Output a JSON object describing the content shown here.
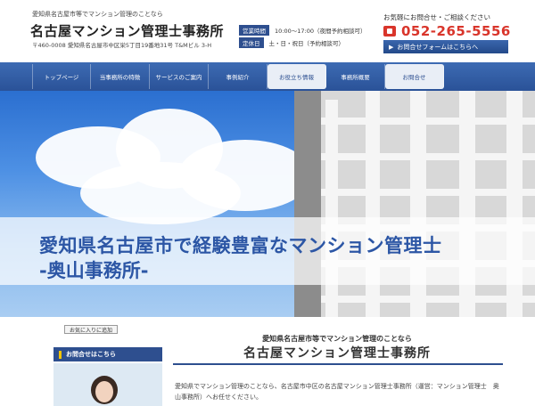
{
  "header": {
    "tagline": "愛知県名古屋市等でマンション管理のことなら",
    "site_title": "名古屋マンション管理士事務所",
    "address": "〒460-0008 愛知県名古屋市中区栄5丁目19番地31号 T&Mビル 3-H",
    "hours": [
      {
        "label": "営業時間",
        "value": "10:00～17:00（夜間予約相談可）"
      },
      {
        "label": "定休日",
        "value": "土・日・祝日（予約相談可）"
      }
    ],
    "contact_lead": "お気軽にお問合せ・ご相談ください",
    "phone": "052-265-5556",
    "contact_form_label": "お問合せフォームはこちらへ"
  },
  "nav": {
    "items": [
      {
        "label": "トップページ"
      },
      {
        "label": "当事務所の特徴"
      },
      {
        "label": "サービスのご案内"
      },
      {
        "label": "事例紹介"
      },
      {
        "label": "お役立ち情報"
      },
      {
        "label": "事務所概要"
      },
      {
        "label": "お問合せ"
      }
    ]
  },
  "hero": {
    "line1": "愛知県名古屋市で経験豊富なマンション管理士",
    "line2": "-奥山事務所-"
  },
  "bookmark_label": "お気に入りに追加",
  "sidebar": {
    "contact_heading": "お問合せはこちら"
  },
  "main": {
    "subtitle": "愛知県名古屋市等でマンション管理のことなら",
    "title": "名古屋マンション管理士事務所",
    "body": "愛知県でマンション管理のことなら、名古屋市中区の名古屋マンション管理士事務所（運営：マンション管理士　奥山事務所）へお任せください。"
  },
  "colors": {
    "brand_blue": "#2e4f8f",
    "nav_blue": "#2a5298",
    "phone_red": "#d9352b",
    "hero_text": "#2c56a5"
  }
}
